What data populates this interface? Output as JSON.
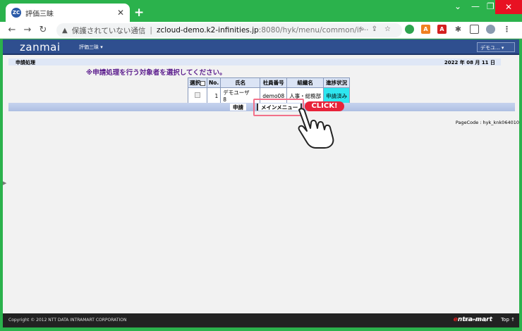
{
  "browser": {
    "tab_title": "評価三昧",
    "favicon_text": "ZC",
    "close_glyph": "✕",
    "new_tab_glyph": "+",
    "minimize_glyph": "—",
    "restore_glyph": "❐",
    "winclose_glyph": "✕",
    "chevron_glyph": "⌄",
    "security_text": "保護されていない通信",
    "separator": "|",
    "url_host": "zcloud-demo.k2-infinities.jp",
    "url_path": ":8080/hyk/menu/common/if···"
  },
  "app": {
    "logo": "zanmai",
    "menu_label": "評価三昧 ▾",
    "user_menu": "デモユ... ▾",
    "page_title": "申請処理",
    "date": "2022 年 08 月 11 日",
    "instruction": "※申請処理を行う対象者を選択してください。",
    "table": {
      "headers": [
        "選択",
        "No.",
        "氏名",
        "社員番号",
        "組織名",
        "進捗状況"
      ],
      "rows": [
        {
          "no": "1",
          "name": "デモユーザ　8",
          "emp_no": "demo08",
          "org": "人事・総務部",
          "status": "申請済み"
        }
      ]
    },
    "apply_button": "申請",
    "main_menu_button": "メインメニュー",
    "click_label": "CLICK!",
    "pagecode": "PageCode : hyk_knk064010",
    "copyright": "Copyright © 2012 NTT DATA INTRAMART CORPORATION",
    "powered_by": "Powered by",
    "intramart_e": "e",
    "intramart_rest": "ntra-mart",
    "top_link": "Top ↑"
  },
  "colors": {
    "chrome": "#2bb24c",
    "header": "#2f4f8f",
    "instruction": "#5a1a8c",
    "status_cell": "#2ee6f0",
    "click_badge": "#e8233a"
  }
}
